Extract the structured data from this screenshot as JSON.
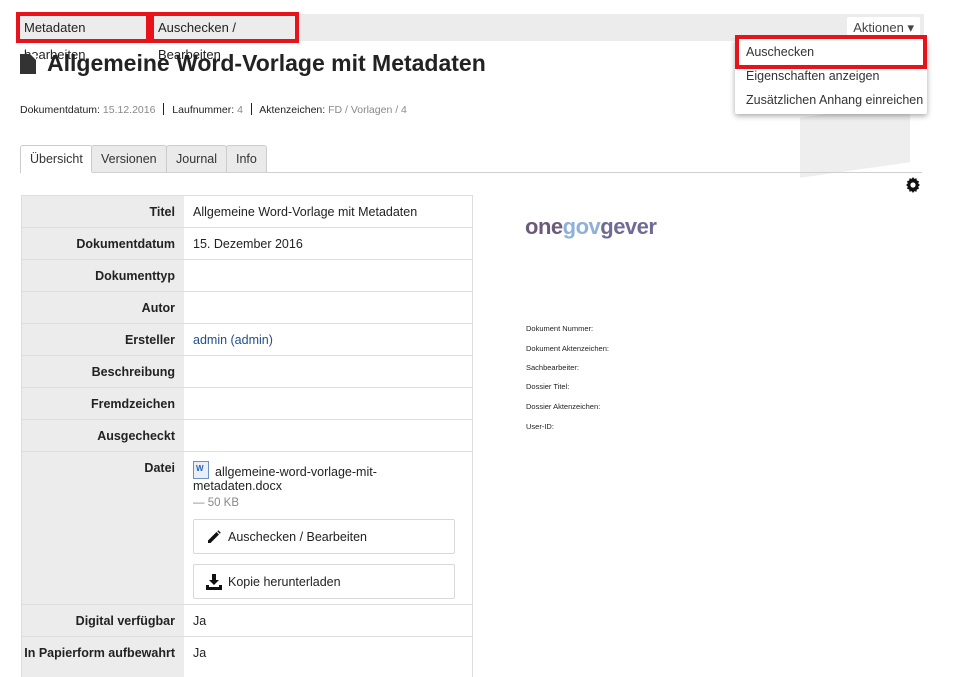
{
  "toolbar": {
    "edit_metadata": "Metadaten bearbeiten",
    "checkout_edit": "Auschecken / Bearbeiten",
    "actions": "Aktionen ▾"
  },
  "dropdown": {
    "items": [
      "Auschecken",
      "Eigenschaften anzeigen",
      "Zusätzlichen Anhang einreichen"
    ]
  },
  "document": {
    "title": "Allgemeine Word-Vorlage mit Metadaten",
    "meta": {
      "date_label": "Dokumentdatum:",
      "date_value": "15.12.2016",
      "seq_label": "Laufnummer:",
      "seq_value": "4",
      "ref_label": "Aktenzeichen:",
      "ref_value": "FD / Vorlagen / 4"
    }
  },
  "tabs": [
    "Übersicht",
    "Versionen",
    "Journal",
    "Info"
  ],
  "overview": {
    "rows": [
      {
        "label": "Titel",
        "value": "Allgemeine Word-Vorlage mit Metadaten"
      },
      {
        "label": "Dokumentdatum",
        "value": "15. Dezember 2016"
      },
      {
        "label": "Dokumenttyp",
        "value": ""
      },
      {
        "label": "Autor",
        "value": ""
      },
      {
        "label": "Ersteller",
        "value": "admin (admin)"
      },
      {
        "label": "Beschreibung",
        "value": ""
      },
      {
        "label": "Fremdzeichen",
        "value": ""
      },
      {
        "label": "Ausgecheckt",
        "value": ""
      },
      {
        "label": "Datei",
        "value": ""
      },
      {
        "label": "Digital verfügbar",
        "value": "Ja"
      },
      {
        "label": "In Papierform aufbewahrt",
        "value": "Ja"
      }
    ],
    "file": {
      "name": "allgemeine-word-vorlage-mit-metadaten.docx",
      "size": "— 50 KB",
      "checkout_button": "Auschecken / Bearbeiten",
      "download_button": "Kopie herunterladen"
    }
  },
  "preview": {
    "logo_one": "one",
    "logo_gov": "gov",
    "logo_gever": "gever",
    "fields": [
      "Dokument Nummer:",
      "Dokument Aktenzeichen:",
      "Sachbearbeiter:",
      "Dossier Titel:",
      "Dossier Aktenzeichen:",
      "User-ID:"
    ]
  },
  "colors": {
    "highlight": "#e8121a",
    "link": "#1f4e8c"
  }
}
